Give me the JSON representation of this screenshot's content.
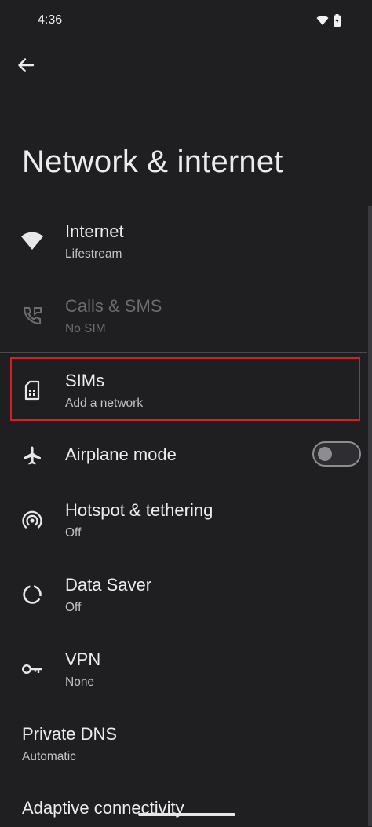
{
  "status_bar": {
    "time": "4:36",
    "icons": [
      "wifi-icon",
      "battery-charging-icon"
    ]
  },
  "header": {
    "back_icon": "arrow-back-icon",
    "title": "Network & internet"
  },
  "items": [
    {
      "icon": "wifi-icon",
      "label": "Internet",
      "sub": "Lifestream",
      "enabled": true
    },
    {
      "icon": "calls-sms-icon",
      "label": "Calls & SMS",
      "sub": "No SIM",
      "enabled": false
    },
    {
      "icon": "sim-card-icon",
      "label": "SIMs",
      "sub": "Add a network",
      "enabled": true,
      "highlighted": true
    },
    {
      "icon": "airplane-icon",
      "label": "Airplane mode",
      "toggle": false,
      "enabled": true
    },
    {
      "icon": "hotspot-icon",
      "label": "Hotspot & tethering",
      "sub": "Off",
      "enabled": true
    },
    {
      "icon": "data-saver-icon",
      "label": "Data Saver",
      "sub": "Off",
      "enabled": true
    },
    {
      "icon": "vpn-key-icon",
      "label": "VPN",
      "sub": "None",
      "enabled": true
    },
    {
      "label": "Private DNS",
      "sub": "Automatic",
      "enabled": true
    },
    {
      "label": "Adaptive connectivity",
      "enabled": true
    }
  ],
  "colors": {
    "background": "#1f1f21",
    "highlight_border": "#d42020",
    "text_primary": "#ececec",
    "text_secondary": "#c4c3c8",
    "text_disabled": "#6c6b70"
  }
}
